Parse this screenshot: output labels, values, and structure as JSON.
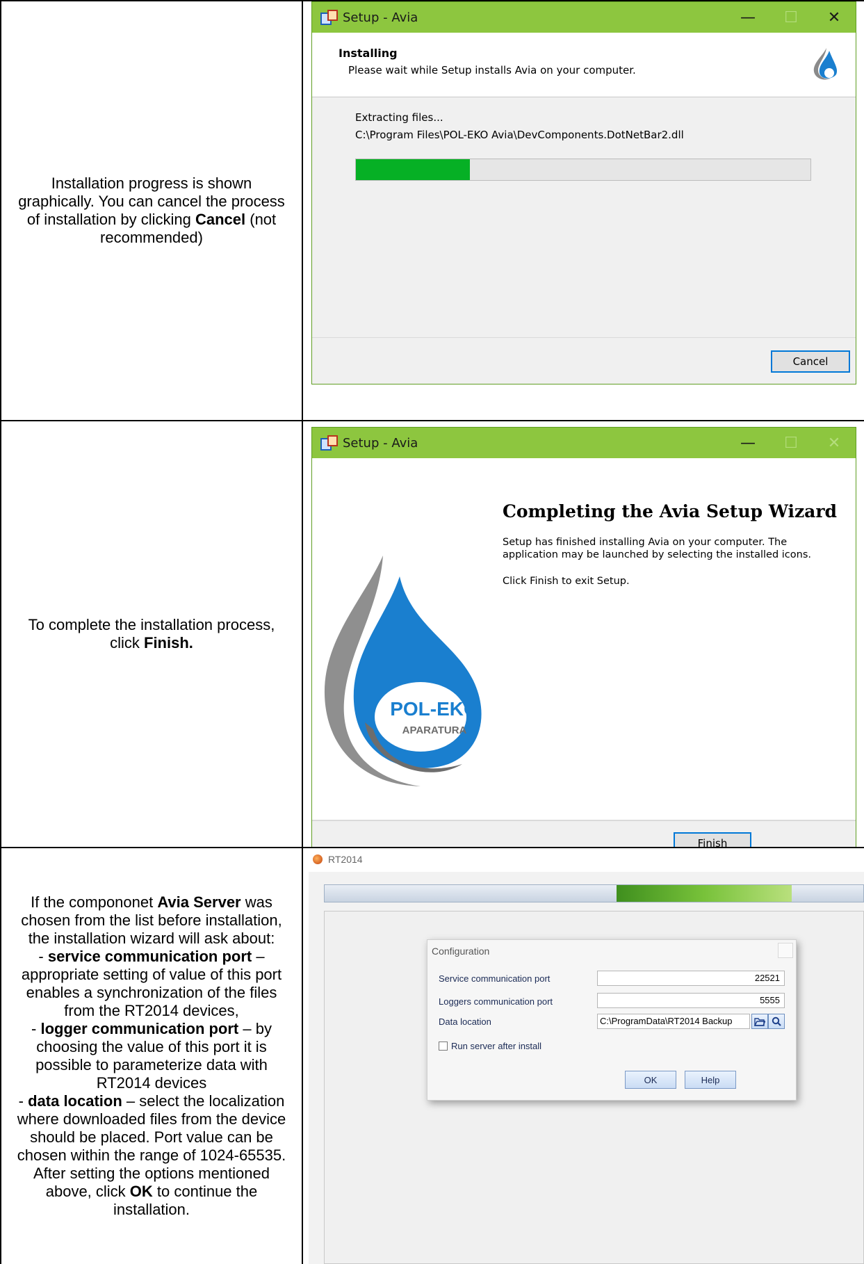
{
  "rows": [
    {
      "description_parts": [
        "Installation progress is shown graphically. You can cancel the process of installation by clicking ",
        "Cancel",
        " (not recommended)"
      ],
      "window": {
        "title": "Setup - Avia",
        "header_title": "Installing",
        "header_subtitle": "Please wait while Setup installs Avia on your computer.",
        "status_line1": "Extracting files...",
        "status_line2": "C:\\Program Files\\POL-EKO Avia\\DevComponents.DotNetBar2.dll",
        "progress_fraction": 0.25,
        "cancel_label": "Cancel"
      }
    },
    {
      "description_parts": [
        "To complete the installation process, click ",
        "Finish."
      ],
      "window": {
        "title": "Setup - Avia",
        "wizard_title": "Completing the Avia Setup Wizard",
        "para1": "Setup has finished installing Avia on your computer. The application may be launched by selecting the installed icons.",
        "para2": "Click Finish to exit Setup.",
        "logo_brand": "POL-EKO",
        "logo_sub": "APARATURA",
        "finish_label": "Finish"
      }
    },
    {
      "description": {
        "p1_a": "If the compononet ",
        "p1_b": "Avia Server",
        "p1_c": " was chosen from the list before installation, the installation wizard will ask about:",
        "p2_dash": "- ",
        "p2_b": "service communication port",
        "p2_c": " – appropriate setting of value of this port enables a synchronization of the files from the RT2014 devices,",
        "p3_dash": "- ",
        "p3_b": "logger communication port",
        "p3_c": " – by choosing the value of this port it is possible to parameterize data with RT2014 devices",
        "p4_dash": "- ",
        "p4_b": "data location",
        "p4_c": " – select the localization where downloaded files from the device should be placed. Port value can be chosen within the range of 1024-65535. After setting the options mentioned above, click ",
        "p4_d": "OK",
        "p4_e": " to continue the installation."
      },
      "app": {
        "title": "RT2014",
        "dialog_title": "Configuration",
        "service_port_label": "Service communication port",
        "service_port_value": "22521",
        "loggers_port_label": "Loggers communication port",
        "loggers_port_value": "5555",
        "data_location_label": "Data location",
        "data_location_value": "C:\\ProgramData\\RT2014 Backup",
        "run_server_label": "Run server after install",
        "run_server_checked": false,
        "ok_label": "OK",
        "help_label": "Help"
      }
    }
  ],
  "colors": {
    "titlebar": "#8dc63f",
    "progress": "#06b025",
    "accent_blue": "#0078d7"
  }
}
